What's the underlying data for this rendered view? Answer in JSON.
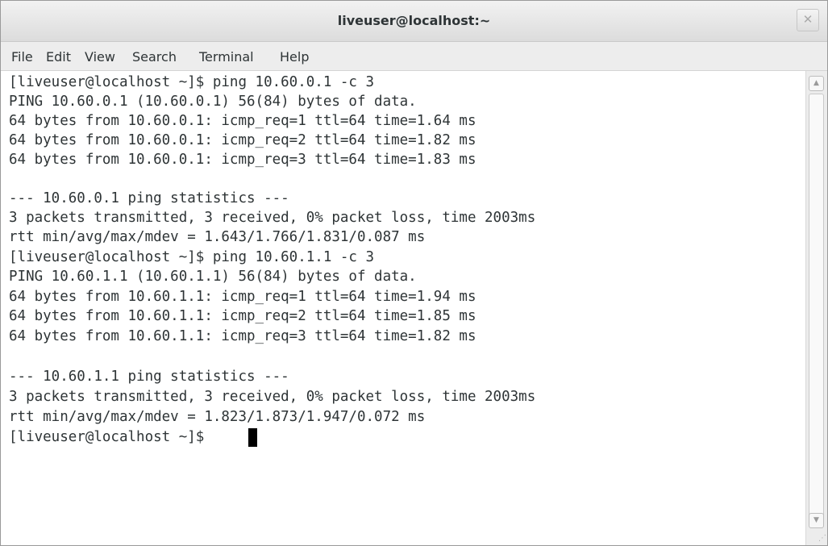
{
  "window": {
    "title": "liveuser@localhost:~",
    "close_icon": "close-icon"
  },
  "menubar": {
    "items": [
      "File",
      "Edit",
      "View",
      "Search",
      "Terminal",
      "Help"
    ]
  },
  "terminal": {
    "lines": [
      "[liveuser@localhost ~]$ ping 10.60.0.1 -c 3",
      "PING 10.60.0.1 (10.60.0.1) 56(84) bytes of data.",
      "64 bytes from 10.60.0.1: icmp_req=1 ttl=64 time=1.64 ms",
      "64 bytes from 10.60.0.1: icmp_req=2 ttl=64 time=1.82 ms",
      "64 bytes from 10.60.0.1: icmp_req=3 ttl=64 time=1.83 ms",
      "",
      "--- 10.60.0.1 ping statistics ---",
      "3 packets transmitted, 3 received, 0% packet loss, time 2003ms",
      "rtt min/avg/max/mdev = 1.643/1.766/1.831/0.087 ms",
      "[liveuser@localhost ~]$ ping 10.60.1.1 -c 3",
      "PING 10.60.1.1 (10.60.1.1) 56(84) bytes of data.",
      "64 bytes from 10.60.1.1: icmp_req=1 ttl=64 time=1.94 ms",
      "64 bytes from 10.60.1.1: icmp_req=2 ttl=64 time=1.85 ms",
      "64 bytes from 10.60.1.1: icmp_req=3 ttl=64 time=1.82 ms",
      "",
      "--- 10.60.1.1 ping statistics ---",
      "3 packets transmitted, 3 received, 0% packet loss, time 2003ms",
      "rtt min/avg/max/mdev = 1.823/1.873/1.947/0.072 ms",
      "[liveuser@localhost ~]$ "
    ],
    "text_color": "#2e3436",
    "background_color": "#ffffff",
    "cursor_color": "#000000"
  },
  "scrollbar": {
    "up_icon": "chevron-up-icon",
    "down_icon": "chevron-down-icon"
  }
}
